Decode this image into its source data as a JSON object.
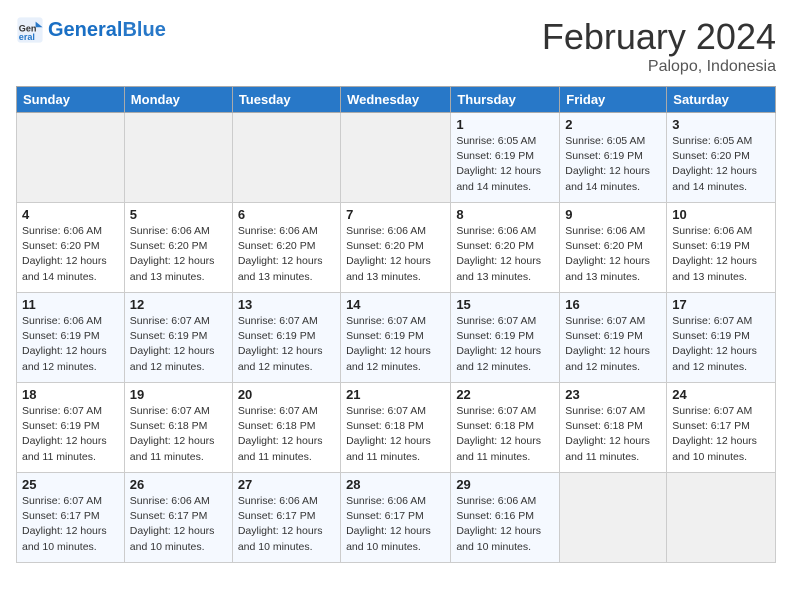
{
  "header": {
    "logo_general": "General",
    "logo_blue": "Blue",
    "month_title": "February 2024",
    "location": "Palopo, Indonesia"
  },
  "days_of_week": [
    "Sunday",
    "Monday",
    "Tuesday",
    "Wednesday",
    "Thursday",
    "Friday",
    "Saturday"
  ],
  "weeks": [
    [
      {
        "day": "",
        "info": ""
      },
      {
        "day": "",
        "info": ""
      },
      {
        "day": "",
        "info": ""
      },
      {
        "day": "",
        "info": ""
      },
      {
        "day": "1",
        "info": "Sunrise: 6:05 AM\nSunset: 6:19 PM\nDaylight: 12 hours\nand 14 minutes."
      },
      {
        "day": "2",
        "info": "Sunrise: 6:05 AM\nSunset: 6:19 PM\nDaylight: 12 hours\nand 14 minutes."
      },
      {
        "day": "3",
        "info": "Sunrise: 6:05 AM\nSunset: 6:20 PM\nDaylight: 12 hours\nand 14 minutes."
      }
    ],
    [
      {
        "day": "4",
        "info": "Sunrise: 6:06 AM\nSunset: 6:20 PM\nDaylight: 12 hours\nand 14 minutes."
      },
      {
        "day": "5",
        "info": "Sunrise: 6:06 AM\nSunset: 6:20 PM\nDaylight: 12 hours\nand 13 minutes."
      },
      {
        "day": "6",
        "info": "Sunrise: 6:06 AM\nSunset: 6:20 PM\nDaylight: 12 hours\nand 13 minutes."
      },
      {
        "day": "7",
        "info": "Sunrise: 6:06 AM\nSunset: 6:20 PM\nDaylight: 12 hours\nand 13 minutes."
      },
      {
        "day": "8",
        "info": "Sunrise: 6:06 AM\nSunset: 6:20 PM\nDaylight: 12 hours\nand 13 minutes."
      },
      {
        "day": "9",
        "info": "Sunrise: 6:06 AM\nSunset: 6:20 PM\nDaylight: 12 hours\nand 13 minutes."
      },
      {
        "day": "10",
        "info": "Sunrise: 6:06 AM\nSunset: 6:19 PM\nDaylight: 12 hours\nand 13 minutes."
      }
    ],
    [
      {
        "day": "11",
        "info": "Sunrise: 6:06 AM\nSunset: 6:19 PM\nDaylight: 12 hours\nand 12 minutes."
      },
      {
        "day": "12",
        "info": "Sunrise: 6:07 AM\nSunset: 6:19 PM\nDaylight: 12 hours\nand 12 minutes."
      },
      {
        "day": "13",
        "info": "Sunrise: 6:07 AM\nSunset: 6:19 PM\nDaylight: 12 hours\nand 12 minutes."
      },
      {
        "day": "14",
        "info": "Sunrise: 6:07 AM\nSunset: 6:19 PM\nDaylight: 12 hours\nand 12 minutes."
      },
      {
        "day": "15",
        "info": "Sunrise: 6:07 AM\nSunset: 6:19 PM\nDaylight: 12 hours\nand 12 minutes."
      },
      {
        "day": "16",
        "info": "Sunrise: 6:07 AM\nSunset: 6:19 PM\nDaylight: 12 hours\nand 12 minutes."
      },
      {
        "day": "17",
        "info": "Sunrise: 6:07 AM\nSunset: 6:19 PM\nDaylight: 12 hours\nand 12 minutes."
      }
    ],
    [
      {
        "day": "18",
        "info": "Sunrise: 6:07 AM\nSunset: 6:19 PM\nDaylight: 12 hours\nand 11 minutes."
      },
      {
        "day": "19",
        "info": "Sunrise: 6:07 AM\nSunset: 6:18 PM\nDaylight: 12 hours\nand 11 minutes."
      },
      {
        "day": "20",
        "info": "Sunrise: 6:07 AM\nSunset: 6:18 PM\nDaylight: 12 hours\nand 11 minutes."
      },
      {
        "day": "21",
        "info": "Sunrise: 6:07 AM\nSunset: 6:18 PM\nDaylight: 12 hours\nand 11 minutes."
      },
      {
        "day": "22",
        "info": "Sunrise: 6:07 AM\nSunset: 6:18 PM\nDaylight: 12 hours\nand 11 minutes."
      },
      {
        "day": "23",
        "info": "Sunrise: 6:07 AM\nSunset: 6:18 PM\nDaylight: 12 hours\nand 11 minutes."
      },
      {
        "day": "24",
        "info": "Sunrise: 6:07 AM\nSunset: 6:17 PM\nDaylight: 12 hours\nand 10 minutes."
      }
    ],
    [
      {
        "day": "25",
        "info": "Sunrise: 6:07 AM\nSunset: 6:17 PM\nDaylight: 12 hours\nand 10 minutes."
      },
      {
        "day": "26",
        "info": "Sunrise: 6:06 AM\nSunset: 6:17 PM\nDaylight: 12 hours\nand 10 minutes."
      },
      {
        "day": "27",
        "info": "Sunrise: 6:06 AM\nSunset: 6:17 PM\nDaylight: 12 hours\nand 10 minutes."
      },
      {
        "day": "28",
        "info": "Sunrise: 6:06 AM\nSunset: 6:17 PM\nDaylight: 12 hours\nand 10 minutes."
      },
      {
        "day": "29",
        "info": "Sunrise: 6:06 AM\nSunset: 6:16 PM\nDaylight: 12 hours\nand 10 minutes."
      },
      {
        "day": "",
        "info": ""
      },
      {
        "day": "",
        "info": ""
      }
    ]
  ]
}
